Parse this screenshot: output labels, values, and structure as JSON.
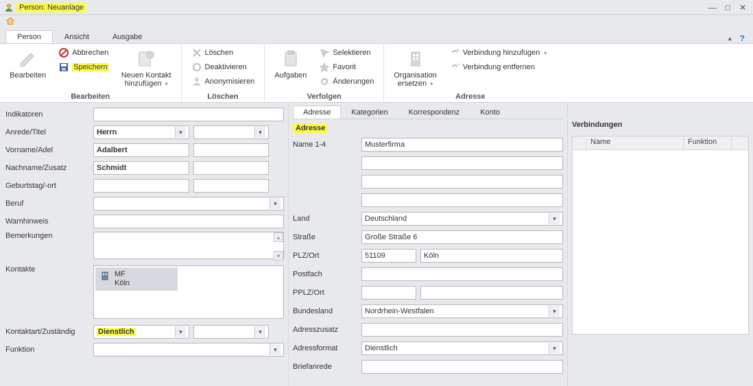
{
  "window": {
    "title": "Person: Neuanlage"
  },
  "menu": {
    "tabs": [
      "Person",
      "Ansicht",
      "Ausgabe"
    ],
    "active": 0
  },
  "ribbon": {
    "groups": {
      "bearbeiten": {
        "label": "Bearbeiten",
        "edit_btn": "Bearbeiten",
        "abbrechen": "Abbrechen",
        "speichern": "Speichern",
        "neuen_kontakt_line1": "Neuen Kontakt",
        "neuen_kontakt_line2": "hinzufügen"
      },
      "loeschen": {
        "label": "Löschen",
        "loeschen": "Löschen",
        "deaktivieren": "Deaktivieren",
        "anonymisieren": "Anonymisieren"
      },
      "verfolgen": {
        "label": "Verfolgen",
        "aufgaben": "Aufgaben",
        "selektieren": "Selektieren",
        "favorit": "Favorit",
        "aenderungen": "Änderungen"
      },
      "adresse": {
        "label": "Adresse",
        "org_ersetzen_line1": "Organisation",
        "org_ersetzen_line2": "ersetzen",
        "verb_hinzu": "Verbindung hinzufügen",
        "verb_entf": "Verbindung entfernen"
      }
    }
  },
  "left": {
    "labels": {
      "indikatoren": "Indikatoren",
      "anrede": "Anrede/Titel",
      "vorname": "Vorname/Adel",
      "nachname": "Nachname/Zusatz",
      "geburtstag": "Geburtstag/-ort",
      "beruf": "Beruf",
      "warn": "Warnhinweis",
      "bemerk": "Bemerkungen",
      "kontakte": "Kontakte",
      "kontaktart": "Kontaktart/Zuständig",
      "funktion": "Funktion"
    },
    "values": {
      "anrede": "Herrn",
      "titel": "",
      "vorname": "Adalbert",
      "adel": "",
      "nachname": "Schmidt",
      "zusatz": "",
      "geburtstag": "",
      "geburtsort": "",
      "beruf": "",
      "warn": "",
      "bemerk": "",
      "kontaktart": "Dienstlich",
      "zustaendig": ""
    },
    "kontakte_item": {
      "abbr": "MF",
      "ort": "Köln"
    }
  },
  "mid": {
    "tabs": [
      "Adresse",
      "Kategorien",
      "Korrespondenz",
      "Konto"
    ],
    "active": 0,
    "section": "Adresse",
    "labels": {
      "name": "Name 1-4",
      "land": "Land",
      "strasse": "Straße",
      "plzort": "PLZ/Ort",
      "postfach": "Postfach",
      "pplzort": "PPLZ/Ort",
      "bundesland": "Bundesland",
      "adresszusatz": "Adresszusatz",
      "adressformat": "Adressformat",
      "briefanrede": "Briefanrede"
    },
    "values": {
      "name1": "Musterfirma",
      "name2": "",
      "name3": "",
      "name4": "",
      "land": "Deutschland",
      "strasse": "Große Straße 6",
      "plz": "51109",
      "ort": "Köln",
      "postfach": "",
      "pplz": "",
      "port": "",
      "bundesland": "Nordrhein-Westfalen",
      "adresszusatz": "",
      "adressformat": "Dienstlich",
      "briefanrede": ""
    }
  },
  "right": {
    "section": "Verbindungen",
    "cols": {
      "name": "Name",
      "funktion": "Funktion"
    }
  }
}
